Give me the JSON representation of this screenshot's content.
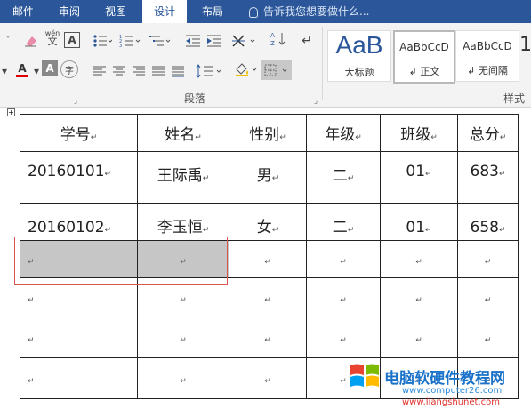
{
  "tabs": [
    {
      "label": "邮件",
      "active": false
    },
    {
      "label": "审阅",
      "active": false
    },
    {
      "label": "视图",
      "active": false
    },
    {
      "label": "设计",
      "active": true
    },
    {
      "label": "布局",
      "active": false
    }
  ],
  "tell_me": "告诉我您想要做什么...",
  "ribbon": {
    "group_paragraph": "段落",
    "group_styles": "样式",
    "wen": "wén",
    "wen2": "文",
    "big_a": "A",
    "zi": "字",
    "styles": [
      {
        "sample": "AaB",
        "name": "大标题"
      },
      {
        "sample": "AaBbCcD",
        "name": "↲ 正文"
      },
      {
        "sample": "AaBbCcD",
        "name": "↲ 无间隔"
      }
    ]
  },
  "table": {
    "headers": [
      "学号",
      "姓名",
      "性别",
      "年级",
      "班级",
      "总分"
    ],
    "rows": [
      [
        "20160101",
        "王际禹",
        "男",
        "二",
        "01",
        "683"
      ],
      [
        "20160102",
        "李玉恒",
        "女",
        "二",
        "01",
        "658"
      ],
      [
        "",
        "",
        "",
        "",
        "",
        ""
      ],
      [
        "",
        "",
        "",
        "",
        "",
        ""
      ],
      [
        "",
        "",
        "",
        "",
        "",
        ""
      ],
      [
        "",
        "",
        "",
        "",
        "",
        ""
      ]
    ],
    "para_mark": "↵"
  },
  "watermark": {
    "title": "电脑软硬件教程网",
    "url1": "www.computer26.com",
    "url2": "www.liangshunet.com"
  },
  "colors": {
    "ribbon_tab": "#2b579a",
    "selection": "#c6c6c6",
    "highlight_box": "#d9534f"
  }
}
